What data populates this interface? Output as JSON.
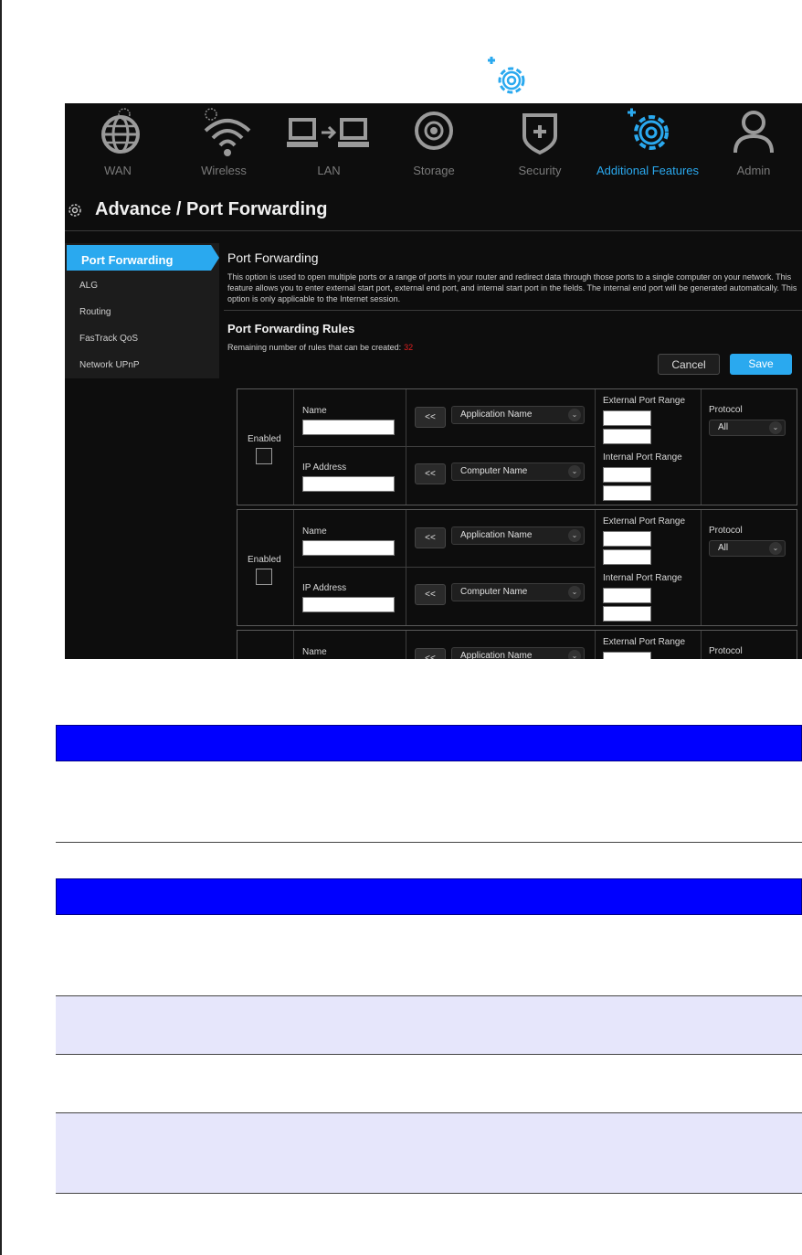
{
  "nav": {
    "items": [
      {
        "label": "WAN",
        "icon": "globe-icon"
      },
      {
        "label": "Wireless",
        "icon": "wifi-icon"
      },
      {
        "label": "LAN",
        "icon": "lan-icon"
      },
      {
        "label": "Storage",
        "icon": "storage-icon"
      },
      {
        "label": "Security",
        "icon": "shield-icon"
      },
      {
        "label": "Additional Features",
        "icon": "gear-icon",
        "active": true
      },
      {
        "label": "Admin",
        "icon": "user-icon"
      }
    ],
    "accent": "#2aa9ef"
  },
  "page": {
    "title": "Advance / Port Forwarding"
  },
  "sidebar": {
    "items": [
      {
        "label": "Port Forwarding",
        "active": true
      },
      {
        "label": "ALG"
      },
      {
        "label": "Routing"
      },
      {
        "label": "FasTrack QoS"
      },
      {
        "label": "Network UPnP"
      }
    ]
  },
  "section": {
    "title": "Port Forwarding",
    "description": "This option is used to open multiple ports or a range of ports in your router and redirect data through those ports to a single computer on your network. This feature allows you to enter external start port, external end port, and internal start port in the fields. The internal end port will be generated automatically. This option is only applicable to the Internet session.",
    "rules_title": "Port Forwarding Rules",
    "remaining_label": "Remaining number of rules that can be created:",
    "remaining_count": "32"
  },
  "buttons": {
    "cancel": "Cancel",
    "save": "Save"
  },
  "rule_form": {
    "enabled_label": "Enabled",
    "name_label": "Name",
    "ip_label": "IP Address",
    "arrow_label": "<<",
    "app_select": "Application Name",
    "computer_select": "Computer Name",
    "external_label": "External Port Range",
    "internal_label": "Internal Port Range",
    "protocol_label": "Protocol",
    "protocol_value": "All"
  }
}
